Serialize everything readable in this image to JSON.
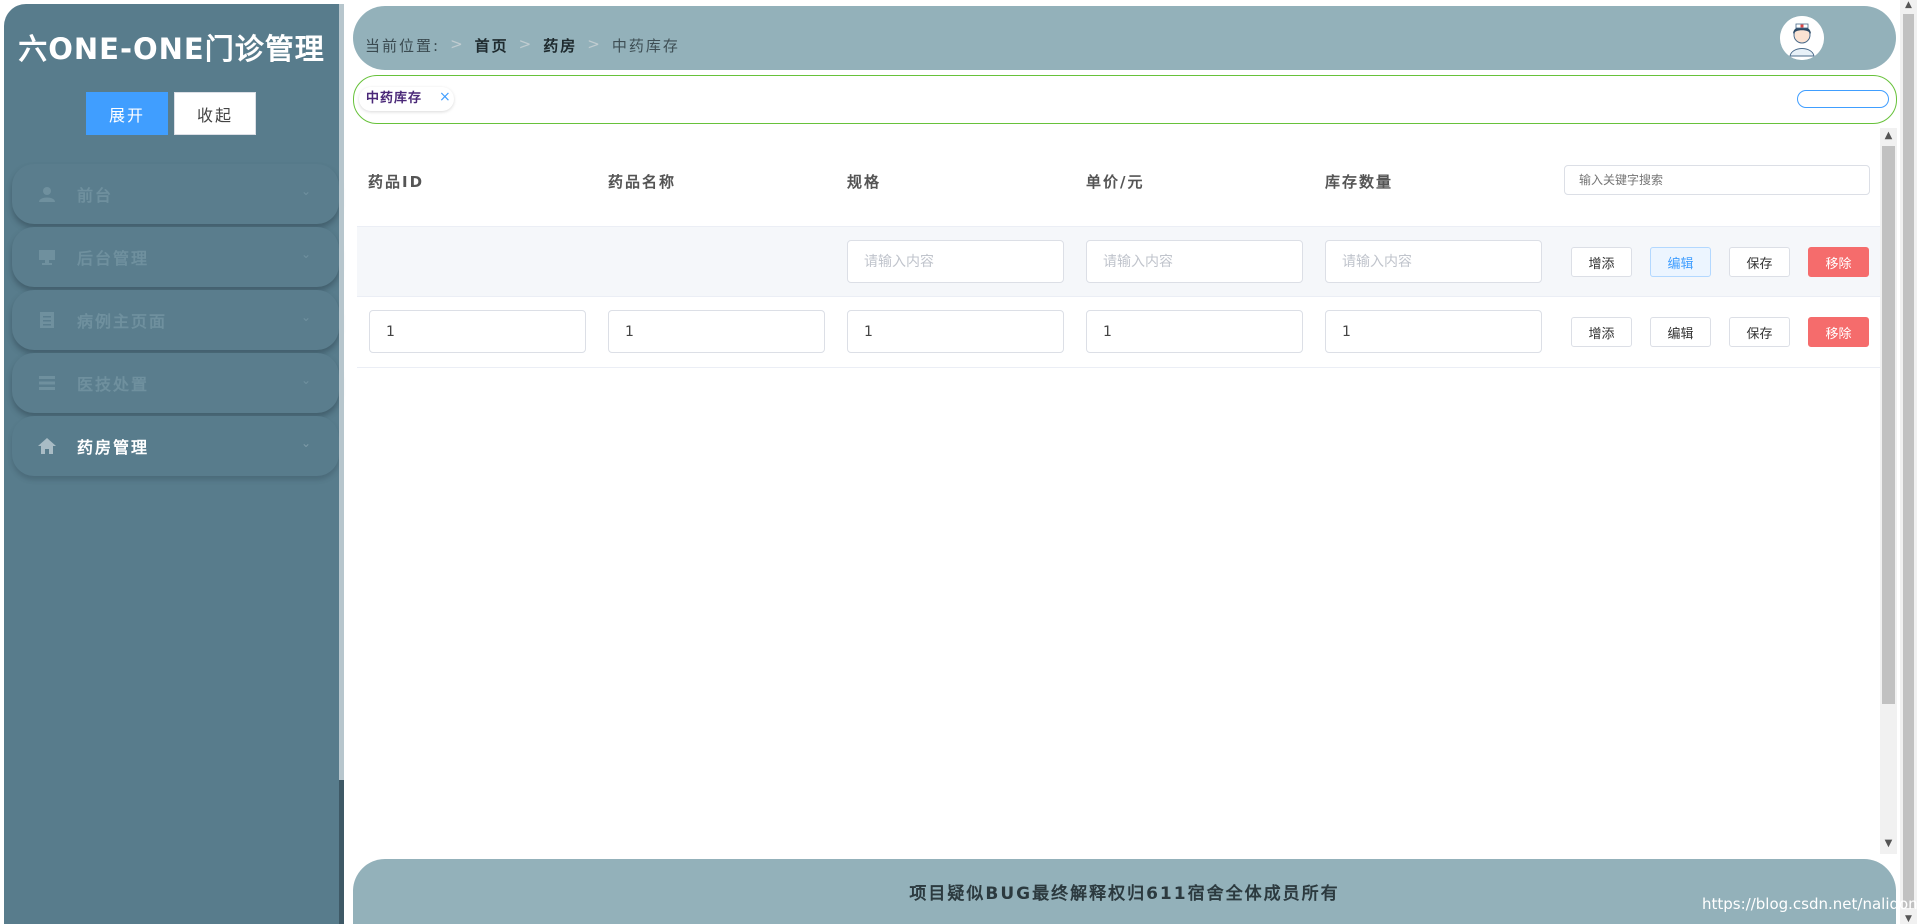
{
  "sidebar": {
    "app_title": "六ONE-ONE门诊管理",
    "expand_label": "展开",
    "collapse_label": "收起",
    "items": [
      {
        "label": "前台",
        "icon": "user-icon",
        "chevron": "⌄"
      },
      {
        "label": "后台管理",
        "icon": "monitor-icon",
        "chevron": "⌄"
      },
      {
        "label": "病例主页面",
        "icon": "document-icon",
        "chevron": "⌄"
      },
      {
        "label": "医技处置",
        "icon": "list-icon",
        "chevron": "⌄"
      },
      {
        "label": "药房管理",
        "icon": "home-icon",
        "chevron": "⌄"
      }
    ]
  },
  "header": {
    "location_label": "当前位置:",
    "sep": ">",
    "crumb_home": "首页",
    "crumb_pharmacy": "药房",
    "crumb_current": "中药库存",
    "avatar_icon": "doctor-avatar-icon"
  },
  "tags": {
    "active_tag": "中药库存",
    "close_glyph": "×"
  },
  "table": {
    "headers": [
      "药品ID",
      "药品名称",
      "规格",
      "单价/元",
      "库存数量"
    ],
    "search_placeholder": "输入关键字搜索",
    "new_row_placeholder": "请输入内容",
    "rows": [
      {
        "id": "1",
        "name": "1",
        "spec": "1",
        "price": "1",
        "stock": "1"
      }
    ],
    "actions": {
      "add": "增添",
      "edit": "编辑",
      "save": "保存",
      "remove": "移除"
    }
  },
  "footer": {
    "text": "项目疑似BUG最终解释权归611宿舍全体成员所有",
    "watermark": "https://blog.csdn.net/nalidong"
  },
  "scrollbar": {
    "up": "▲",
    "down": "▼"
  },
  "colors": {
    "sidebar_bg": "#587c8c",
    "header_bg": "#93b1ba",
    "primary": "#409eff",
    "danger": "#f56c6c",
    "tag_border": "#67c23a"
  }
}
